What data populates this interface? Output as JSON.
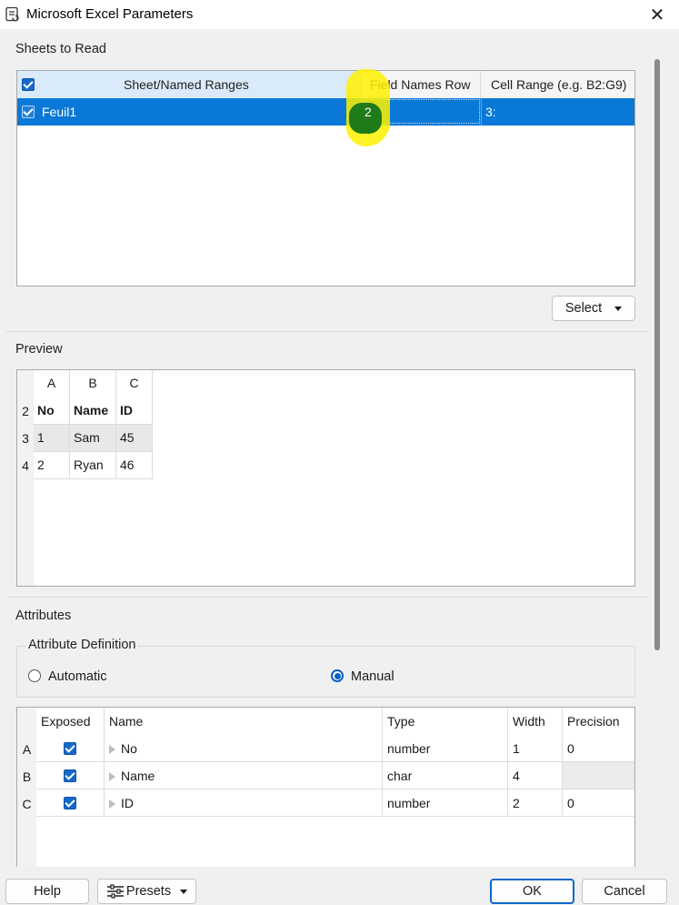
{
  "window": {
    "title": "Microsoft Excel Parameters"
  },
  "sheets_section": {
    "title": "Sheets to Read",
    "columns": [
      "Sheet/Named Ranges",
      "Field Names Row",
      "Cell Range (e.g. B2:G9)"
    ],
    "rows": [
      {
        "name": "Feuil1",
        "field_names_row": "2",
        "cell_range": "3:",
        "checked": true
      }
    ],
    "select_label": "Select"
  },
  "preview_section": {
    "title": "Preview",
    "col_headers": [
      "A",
      "B",
      "C"
    ],
    "rows": [
      {
        "rownum": "2",
        "cells": [
          "No",
          "Name",
          "ID"
        ]
      },
      {
        "rownum": "3",
        "cells": [
          "1",
          "Sam",
          "45"
        ]
      },
      {
        "rownum": "4",
        "cells": [
          "2",
          "Ryan",
          "46"
        ]
      }
    ]
  },
  "attributes_section": {
    "title": "Attributes",
    "definition_title": "Attribute Definition",
    "automatic_label": "Automatic",
    "manual_label": "Manual",
    "selected_mode": "Manual",
    "columns": [
      "Exposed",
      "Name",
      "Type",
      "Width",
      "Precision"
    ],
    "rows": [
      {
        "letter": "A",
        "exposed": true,
        "name": "No",
        "type": "number",
        "width": "1",
        "precision": "0"
      },
      {
        "letter": "B",
        "exposed": true,
        "name": "Name",
        "type": "char",
        "width": "4",
        "precision": ""
      },
      {
        "letter": "C",
        "exposed": true,
        "name": "ID",
        "type": "number",
        "width": "2",
        "precision": "0"
      }
    ]
  },
  "footer": {
    "help_label": "Help",
    "presets_label": "Presets",
    "ok_label": "OK",
    "cancel_label": "Cancel"
  },
  "colors": {
    "accent": "#0a78d7",
    "highlight": "#fff000"
  }
}
